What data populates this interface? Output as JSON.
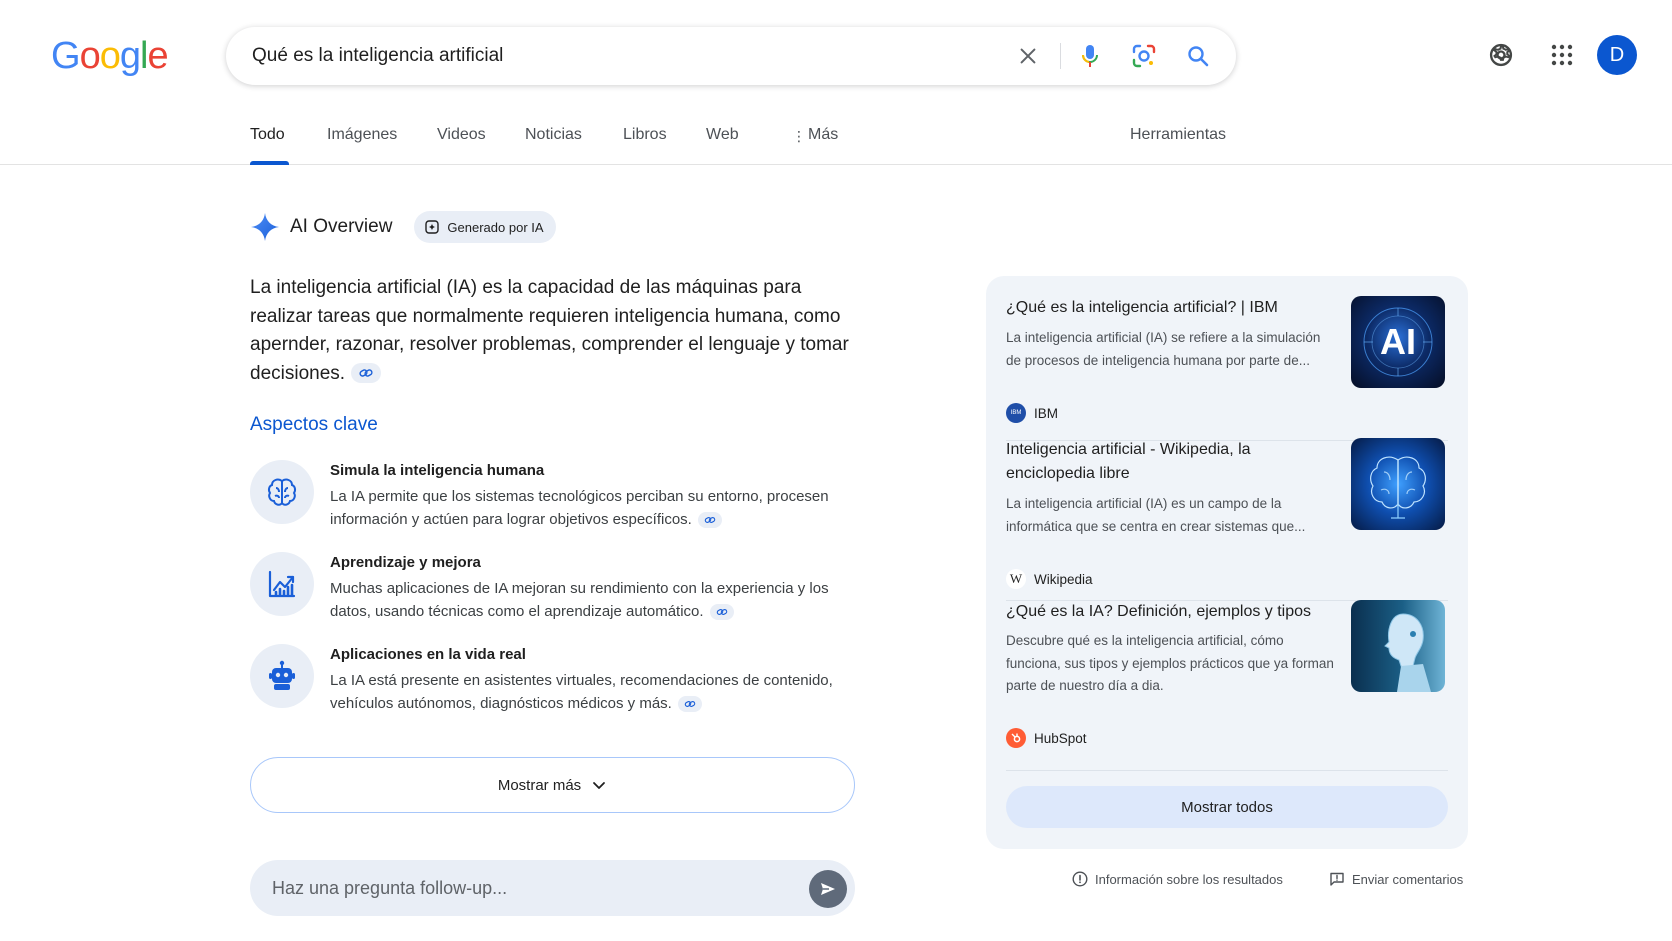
{
  "logo": {
    "text": "Google",
    "letters": [
      "G",
      "o",
      "o",
      "g",
      "l",
      "e"
    ]
  },
  "search": {
    "query": "Qué es la inteligencia artificial",
    "icons": [
      "clear-icon",
      "mic-icon",
      "lens-icon",
      "search-icon"
    ]
  },
  "header": {
    "avatar_initial": "D",
    "icons": [
      "gear-icon",
      "apps-icon"
    ]
  },
  "tabs": [
    {
      "label": "Todo",
      "active": true
    },
    {
      "label": "Imágenes"
    },
    {
      "label": "Videos"
    },
    {
      "label": "Noticias"
    },
    {
      "label": "Libros"
    },
    {
      "label": "Web"
    },
    {
      "label": "Más"
    }
  ],
  "tools_label": "Herramientas",
  "ai_overview": {
    "title": "AI Overview",
    "badge": "Generado por IA",
    "summary": "La inteligencia artificial (IA) es la capacidad de las máquinas para realizar tareas que normalmente requieren inteligencia humana, como apernder, razonar, resolver problemas, comprender el lenguaje y tomar decisiones.",
    "key_title": "Aspectos clave",
    "key_points": [
      {
        "icon": "brain-icon",
        "title": "Simula la inteligencia humana",
        "desc": "La IA permite que los sistemas tecnológicos perciban su entorno, procesen información y actúen para lograr objetivos específicos."
      },
      {
        "icon": "chart-icon",
        "title": "Aprendizaje y mejora",
        "desc": "Muchas aplicaciones de IA mejoran su rendimiento con la experiencia y los datos, usando técnicas como el aprendizaje automático."
      },
      {
        "icon": "robot-icon",
        "title": "Aplicaciones en la vida real",
        "desc": "La IA está presente en asistentes virtuales, recomendaciones de contenido, vehículos autónomos, diagnósticos médicos y más."
      }
    ],
    "show_more": "Mostrar más",
    "followup_placeholder": "Haz una pregunta follow-up..."
  },
  "sources": {
    "items": [
      {
        "title": "¿Qué es la inteligencia artificial? | IBM",
        "snippet": "La inteligencia artificial (IA) se refiere a la simulación de procesos de inteligencia humana por parte de...",
        "site": "IBM",
        "favicon_text": "IBM",
        "thumb_text": "AI"
      },
      {
        "title": "Inteligencia artificial - Wikipedia, la enciclopedia libre",
        "snippet": "La inteligencia artificial (IA) es un campo de la informática que se centra en crear sistemas que...",
        "site": "Wikipedia",
        "favicon_text": "W"
      },
      {
        "title": "¿Qué es la IA? Definición, ejemplos y tipos",
        "snippet": "Descubre qué es la inteligencia artificial, cómo funciona, sus tipos y ejemplos prácticos que ya forman parte de nuestro día a dia.",
        "site": "HubSpot"
      }
    ],
    "show_all": "Mostrar todos"
  },
  "footer": {
    "info": "Información sobre los resultados",
    "feedback": "Enviar comentarios"
  },
  "colors": {
    "accent": "#0b57d0",
    "panel": "#f0f4f9",
    "chip": "#e9eef6"
  }
}
